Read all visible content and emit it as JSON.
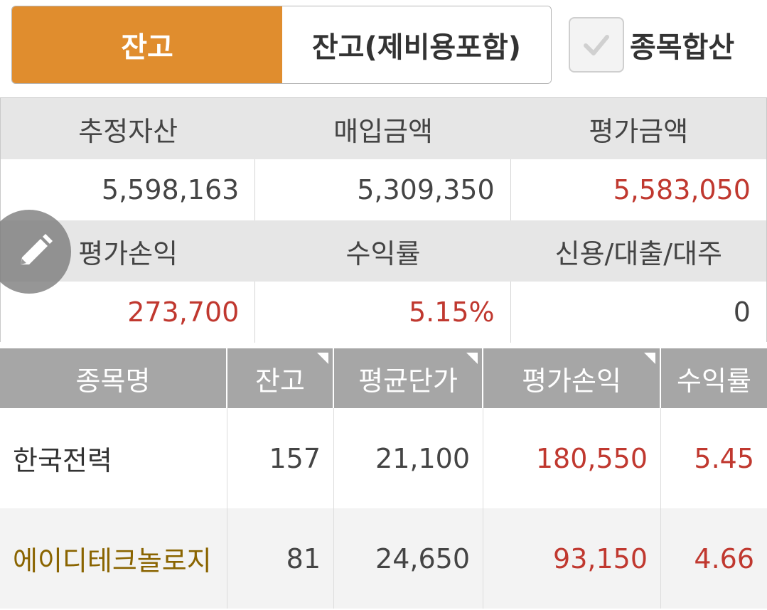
{
  "tabs": {
    "balance": "잔고",
    "balance_with_fees": "잔고(제비용포함)",
    "combine_label": "종목합산",
    "combine_checked": true
  },
  "summary": {
    "headers_row1": [
      "추정자산",
      "매입금액",
      "평가금액"
    ],
    "values_row1": [
      "5,598,163",
      "5,309,350",
      "5,583,050"
    ],
    "headers_row2": [
      "평가손익",
      "수익률",
      "신용/대출/대주"
    ],
    "values_row2": [
      "273,700",
      "5.15%",
      "0"
    ]
  },
  "table": {
    "headers": [
      "종목명",
      "잔고",
      "평균단가",
      "평가손익",
      "수익률"
    ],
    "rows": [
      {
        "name": "한국전력",
        "qty": "157",
        "avg_price": "21,100",
        "profit": "180,550",
        "rate": "5.45"
      },
      {
        "name": "에이디테크놀로지",
        "qty": "81",
        "avg_price": "24,650",
        "profit": "93,150",
        "rate": "4.66"
      }
    ]
  },
  "icons": {
    "edit": "pencil-icon",
    "check": "check-icon",
    "sort": "sort-corner-icon"
  },
  "colors": {
    "accent": "#e08d2e",
    "positive": "#c0382f",
    "highlight_name": "#8a6400"
  }
}
